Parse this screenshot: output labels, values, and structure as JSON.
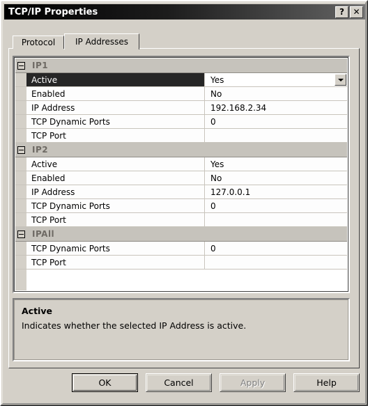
{
  "window": {
    "title": "TCP/IP Properties",
    "help_button": "?",
    "close_button": "✕"
  },
  "tabs": [
    {
      "label": "Protocol",
      "selected": false
    },
    {
      "label": "IP Addresses",
      "selected": true
    }
  ],
  "grid": {
    "groups": [
      {
        "name": "IP1",
        "rows": [
          {
            "name": "Active",
            "value": "Yes",
            "selected": true,
            "dropdown": true
          },
          {
            "name": "Enabled",
            "value": "No",
            "selected": false,
            "dropdown": false
          },
          {
            "name": "IP Address",
            "value": "192.168.2.34",
            "selected": false,
            "dropdown": false
          },
          {
            "name": "TCP Dynamic Ports",
            "value": "0",
            "selected": false,
            "dropdown": false
          },
          {
            "name": "TCP Port",
            "value": "",
            "selected": false,
            "dropdown": false
          }
        ]
      },
      {
        "name": "IP2",
        "rows": [
          {
            "name": "Active",
            "value": "Yes",
            "selected": false,
            "dropdown": false
          },
          {
            "name": "Enabled",
            "value": "No",
            "selected": false,
            "dropdown": false
          },
          {
            "name": "IP Address",
            "value": "127.0.0.1",
            "selected": false,
            "dropdown": false
          },
          {
            "name": "TCP Dynamic Ports",
            "value": "0",
            "selected": false,
            "dropdown": false
          },
          {
            "name": "TCP Port",
            "value": "",
            "selected": false,
            "dropdown": false
          }
        ]
      },
      {
        "name": "IPAll",
        "rows": [
          {
            "name": "TCP Dynamic Ports",
            "value": "0",
            "selected": false,
            "dropdown": false
          },
          {
            "name": "TCP Port",
            "value": "",
            "selected": false,
            "dropdown": false
          }
        ]
      }
    ]
  },
  "description": {
    "title": "Active",
    "text": "Indicates whether the selected IP Address is active."
  },
  "buttons": [
    {
      "label": "OK",
      "default": true,
      "disabled": false
    },
    {
      "label": "Cancel",
      "default": false,
      "disabled": false
    },
    {
      "label": "Apply",
      "default": false,
      "disabled": true
    },
    {
      "label": "Help",
      "default": false,
      "disabled": false
    }
  ],
  "colors": {
    "dialog_face": "#d4d0c8",
    "titlebar_start": "#000000",
    "titlebar_end": "#7a7a7a",
    "selection": "#262626",
    "group_header": "#c6c3bc",
    "grid_background": "#ffffff"
  }
}
